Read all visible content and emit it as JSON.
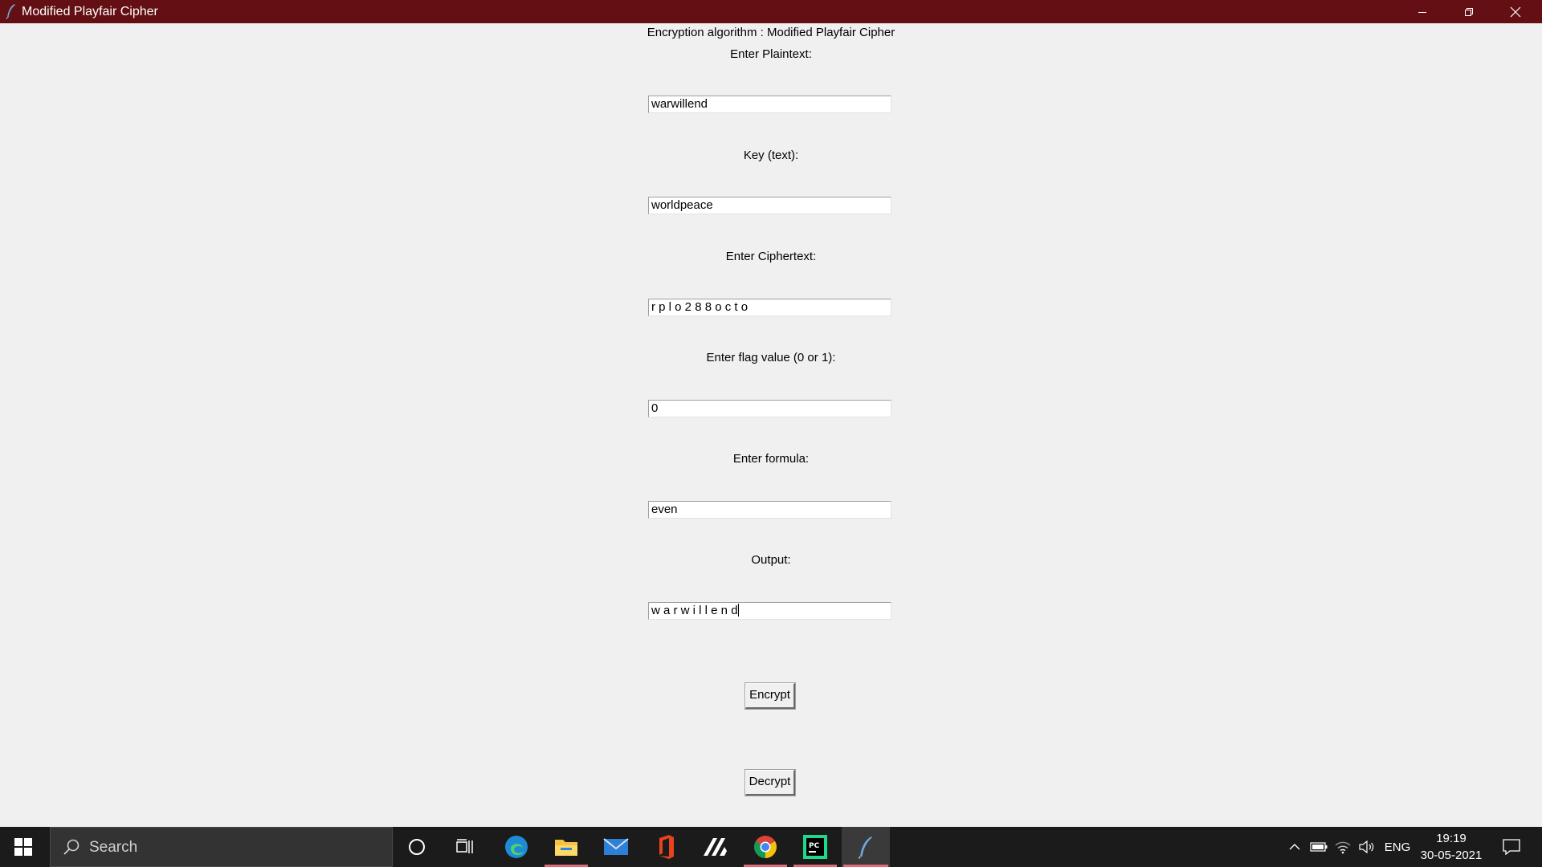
{
  "window": {
    "title": "Modified Playfair Cipher"
  },
  "form": {
    "heading": "Encryption algorithm : Modified Playfair Cipher",
    "plaintext_label": "Enter Plaintext:",
    "plaintext_value": "warwillend",
    "key_label": "Key (text):",
    "key_value": "worldpeace",
    "ciphertext_label": "Enter Ciphertext:",
    "ciphertext_value": "r p l o 2 8 8 o c t o",
    "flag_label": "Enter flag value (0 or 1):",
    "flag_value": "0",
    "formula_label": "Enter formula:",
    "formula_value": "even",
    "output_label": "Output:",
    "output_value": "w a r w i l l e n d",
    "encrypt_label": "Encrypt",
    "decrypt_label": "Decrypt"
  },
  "taskbar": {
    "search_placeholder": "Search",
    "language": "ENG",
    "time": "19:19",
    "date": "30-05-2021",
    "icons": [
      "windows-start-icon",
      "search-icon",
      "cortana-icon",
      "task-view-icon",
      "edge-icon",
      "file-explorer-icon",
      "mail-icon",
      "office-icon",
      "app-icon",
      "chrome-icon",
      "pycharm-icon",
      "feather-app-icon"
    ]
  },
  "colors": {
    "titlebar": "#630f13",
    "window_bg": "#f0f0f0",
    "taskbar_bg": "#1b1b1b"
  }
}
